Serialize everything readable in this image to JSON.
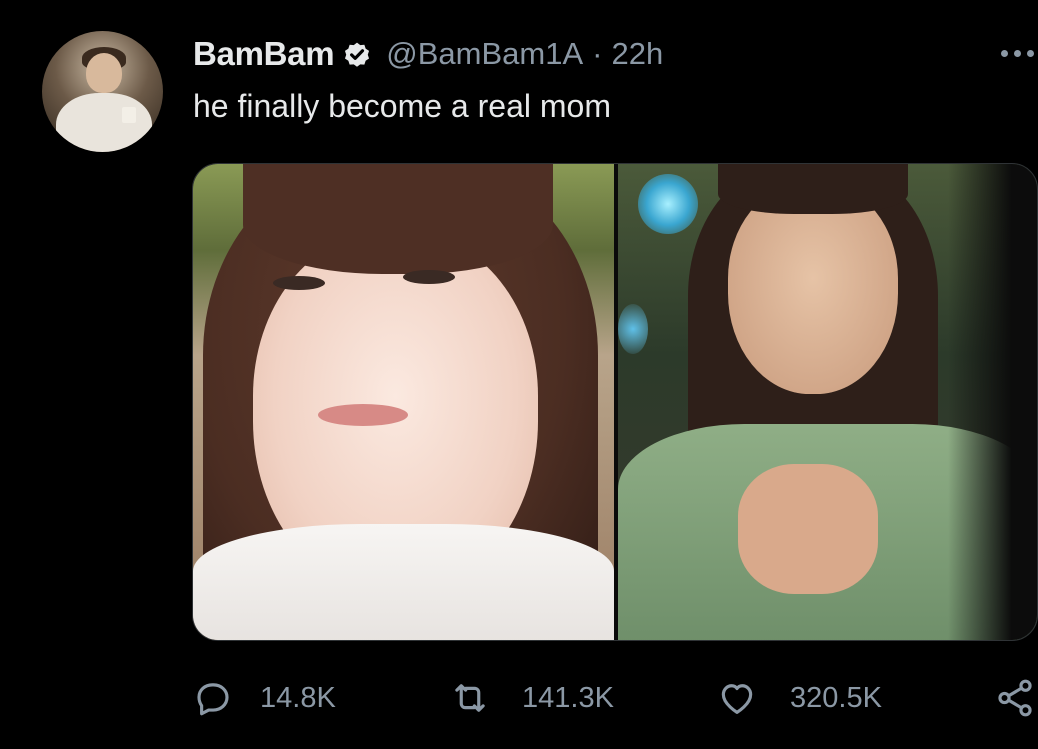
{
  "tweet": {
    "display_name": "BamBam",
    "verified_icon": "verified-badge-icon",
    "handle": "@BamBam1A",
    "separator": "·",
    "time": "22h",
    "text": "he finally become a real mom"
  },
  "media": {
    "images": [
      {
        "name": "left-photo"
      },
      {
        "name": "right-photo"
      }
    ]
  },
  "actions": {
    "reply": {
      "icon": "reply-icon",
      "count": "14.8K"
    },
    "retweet": {
      "icon": "retweet-icon",
      "count": "141.3K"
    },
    "like": {
      "icon": "heart-icon",
      "count": "320.5K"
    },
    "share": {
      "icon": "share-icon"
    }
  },
  "colors": {
    "background": "#000000",
    "primary_text": "#e7e9ea",
    "secondary_text": "#8b98a5",
    "border": "#2f3336"
  }
}
